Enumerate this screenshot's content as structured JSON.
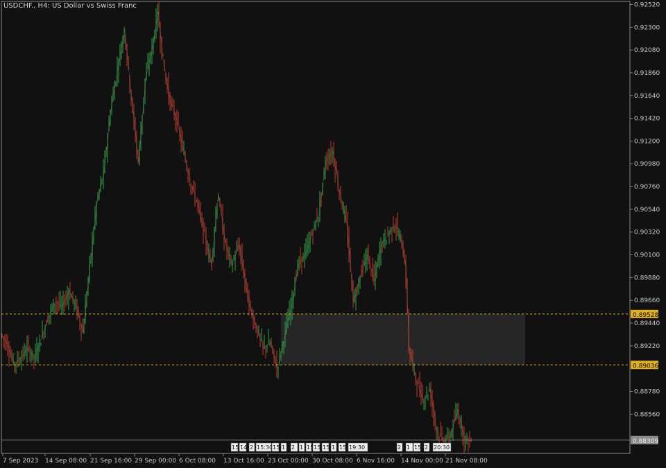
{
  "window": {
    "title": "USDCHF., H4:  US Dollar vs Swiss Franc"
  },
  "colors": {
    "bull": "#2ea043",
    "bear": "#c0392b",
    "level": "#e0b020",
    "zone": "#262626",
    "axis": "#8a8a8a",
    "current": "#808080",
    "background": "#111111"
  },
  "chart_data": {
    "type": "candlestick",
    "symbol": "USDCHF.",
    "timeframe": "H4",
    "ylim": [
      0.8818,
      0.9255
    ],
    "y_ticks": [
      "0.92520",
      "0.92300",
      "0.92080",
      "0.91860",
      "0.91640",
      "0.91420",
      "0.91200",
      "0.90980",
      "0.90760",
      "0.90540",
      "0.90320",
      "0.90100",
      "0.89880",
      "0.89660",
      "0.89440",
      "0.89220",
      "0.88780",
      "0.88560"
    ],
    "x_labels": [
      "7 Sep 2023",
      "14 Sep 08:00",
      "21 Sep 16:00",
      "29 Sep 00:00",
      "6 Oct 08:00",
      "13 Oct 16:00",
      "23 Oct 00:00",
      "30 Oct 08:00",
      "6 Nov 16:00",
      "14 Nov 00:00",
      "21 Nov 08:00"
    ],
    "price_path": [
      [
        0,
        0.8935
      ],
      [
        10,
        0.8925
      ],
      [
        20,
        0.8905
      ],
      [
        30,
        0.891
      ],
      [
        40,
        0.892
      ],
      [
        50,
        0.891
      ],
      [
        60,
        0.893
      ],
      [
        70,
        0.895
      ],
      [
        80,
        0.8965
      ],
      [
        90,
        0.896
      ],
      [
        100,
        0.8975
      ],
      [
        110,
        0.896
      ],
      [
        120,
        0.8935
      ],
      [
        130,
        0.9
      ],
      [
        140,
        0.906
      ],
      [
        150,
        0.909
      ],
      [
        160,
        0.915
      ],
      [
        170,
        0.919
      ],
      [
        180,
        0.9228
      ],
      [
        190,
        0.916
      ],
      [
        200,
        0.91
      ],
      [
        210,
        0.918
      ],
      [
        220,
        0.921
      ],
      [
        228,
        0.9245
      ],
      [
        235,
        0.92
      ],
      [
        245,
        0.916
      ],
      [
        255,
        0.914
      ],
      [
        265,
        0.911
      ],
      [
        275,
        0.908
      ],
      [
        285,
        0.906
      ],
      [
        295,
        0.903
      ],
      [
        305,
        0.9
      ],
      [
        315,
        0.907
      ],
      [
        325,
        0.902
      ],
      [
        335,
        0.9
      ],
      [
        345,
        0.902
      ],
      [
        355,
        0.898
      ],
      [
        360,
        0.896
      ],
      [
        370,
        0.894
      ],
      [
        380,
        0.892
      ],
      [
        390,
        0.8925
      ],
      [
        400,
        0.89
      ],
      [
        410,
        0.893
      ],
      [
        420,
        0.896
      ],
      [
        430,
        0.9
      ],
      [
        440,
        0.901
      ],
      [
        450,
        0.903
      ],
      [
        460,
        0.905
      ],
      [
        470,
        0.91
      ],
      [
        480,
        0.911
      ],
      [
        490,
        0.907
      ],
      [
        500,
        0.904
      ],
      [
        510,
        0.8965
      ],
      [
        520,
        0.899
      ],
      [
        530,
        0.901
      ],
      [
        540,
        0.8985
      ],
      [
        550,
        0.902
      ],
      [
        560,
        0.903
      ],
      [
        570,
        0.904
      ],
      [
        580,
        0.902
      ],
      [
        585,
        0.9
      ],
      [
        590,
        0.892
      ],
      [
        600,
        0.889
      ],
      [
        610,
        0.887
      ],
      [
        620,
        0.888
      ],
      [
        630,
        0.884
      ],
      [
        640,
        0.883
      ],
      [
        650,
        0.8835
      ],
      [
        660,
        0.886
      ],
      [
        670,
        0.8832
      ],
      [
        680,
        0.883
      ]
    ],
    "levels": [
      "0.89528",
      "0.89036"
    ],
    "current_price": "0.88309",
    "current_price_label": "0.88309",
    "event_markers": [
      "15",
      "14",
      "2",
      "15:30",
      "15",
      "1",
      "2",
      "1",
      "15",
      "15",
      "15",
      "1",
      "15",
      "19:30",
      "2",
      "1",
      "15",
      "2",
      "20:30"
    ]
  }
}
